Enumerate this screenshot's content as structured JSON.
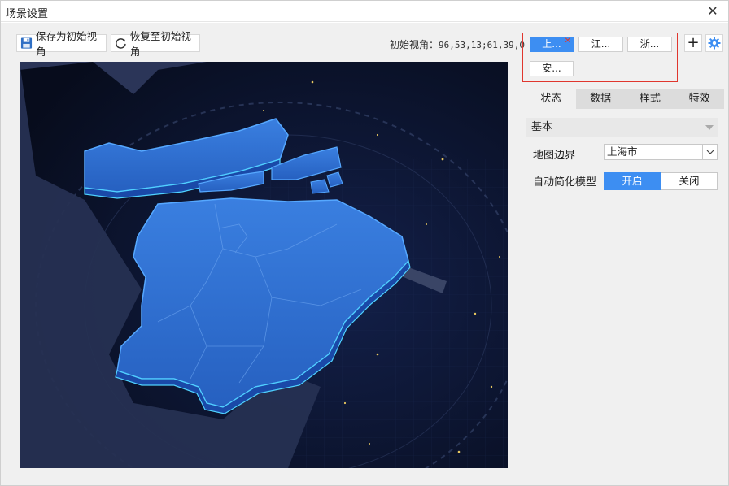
{
  "window": {
    "title": "场景设置"
  },
  "toolbar": {
    "save_label": "保存为初始视角",
    "restore_label": "恢复至初始视角",
    "initial_view_label": "初始视角：",
    "initial_view_value": "96,53,13;61,39,0"
  },
  "region_tabs": [
    {
      "label": "上...",
      "active": true
    },
    {
      "label": "江...",
      "active": false
    },
    {
      "label": "浙...",
      "active": false
    },
    {
      "label": "安...",
      "active": false
    }
  ],
  "props": {
    "tabs": [
      {
        "label": "状态",
        "active": true
      },
      {
        "label": "数据",
        "active": false
      },
      {
        "label": "样式",
        "active": false
      },
      {
        "label": "特效",
        "active": false
      }
    ],
    "section_title": "基本",
    "map_border": {
      "label": "地图边界",
      "value": "上海市"
    },
    "auto_simplify": {
      "label": "自动简化模型",
      "on_label": "开启",
      "off_label": "关闭",
      "value": "on"
    }
  },
  "colors": {
    "accent": "#3d8ef2",
    "highlight_box": "#e0362e",
    "map_bg": "#0b1226"
  },
  "icons": [
    "close-icon",
    "save-icon",
    "refresh-icon",
    "plus-icon",
    "gear-icon",
    "chevron-down-icon"
  ]
}
